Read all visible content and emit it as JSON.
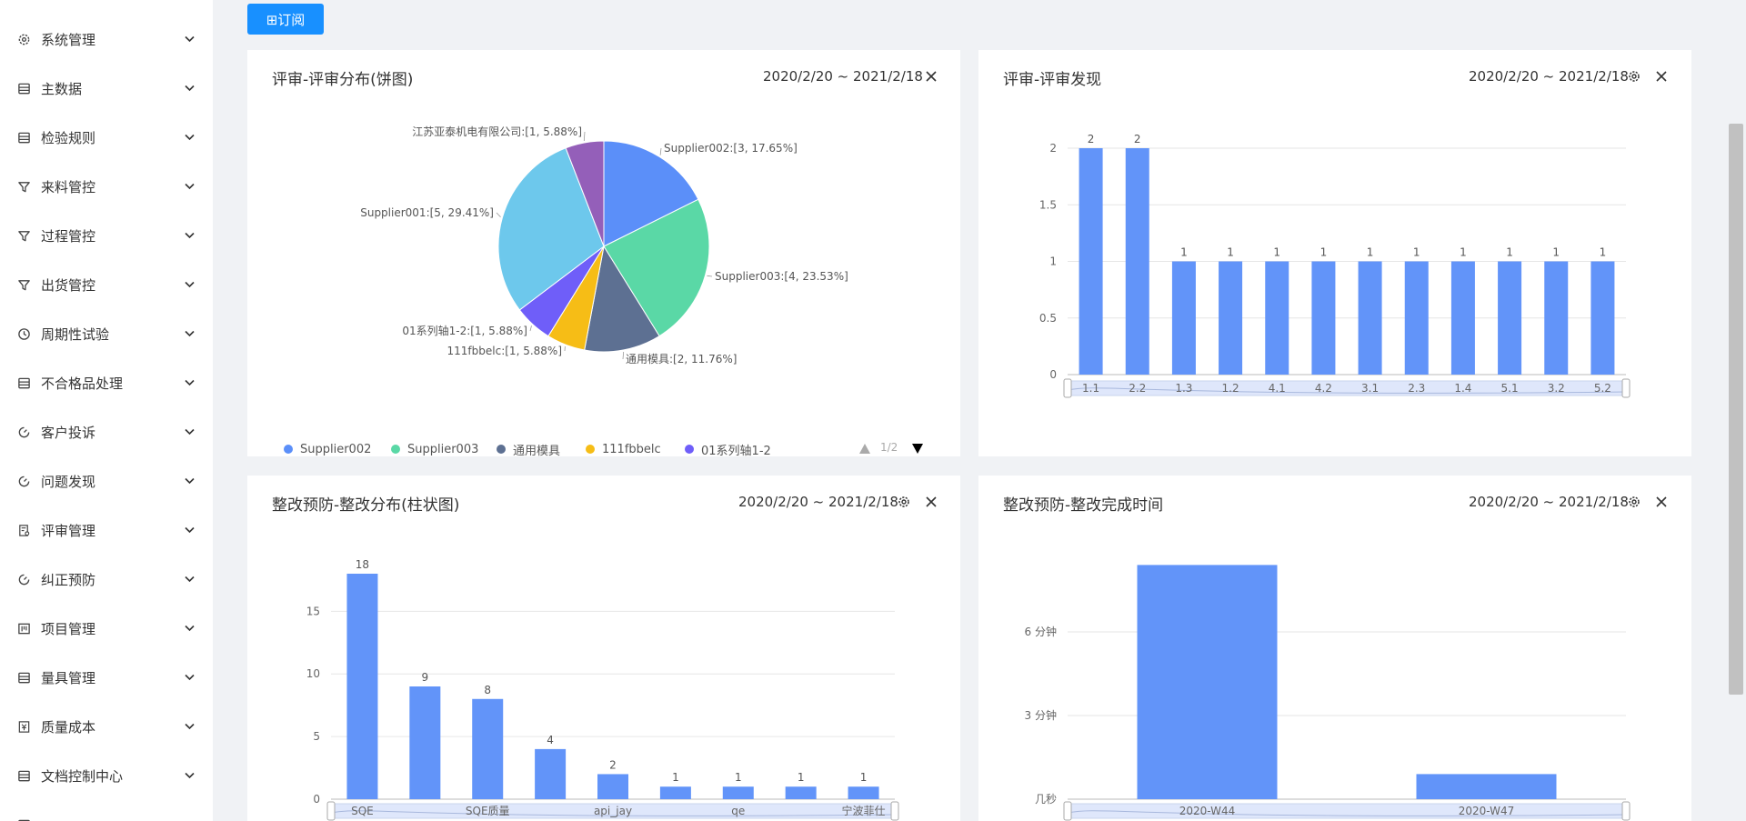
{
  "sidebar": {
    "items": [
      {
        "label": "系统管理",
        "icon": "gear-icon"
      },
      {
        "label": "主数据",
        "icon": "database-icon"
      },
      {
        "label": "检验规则",
        "icon": "database-icon"
      },
      {
        "label": "来料管控",
        "icon": "filter-icon"
      },
      {
        "label": "过程管控",
        "icon": "filter-icon"
      },
      {
        "label": "出货管控",
        "icon": "filter-icon"
      },
      {
        "label": "周期性试验",
        "icon": "clock-icon"
      },
      {
        "label": "不合格品处理",
        "icon": "database-icon"
      },
      {
        "label": "客户投诉",
        "icon": "dashboard-icon"
      },
      {
        "label": "问题发现",
        "icon": "dashboard-icon"
      },
      {
        "label": "评审管理",
        "icon": "audit-icon"
      },
      {
        "label": "纠正预防",
        "icon": "dashboard-icon"
      },
      {
        "label": "项目管理",
        "icon": "project-icon"
      },
      {
        "label": "量具管理",
        "icon": "database-icon"
      },
      {
        "label": "质量成本",
        "icon": "cost-icon"
      },
      {
        "label": "文档控制中心",
        "icon": "database-icon"
      },
      {
        "label": "",
        "icon": "database-icon"
      }
    ]
  },
  "toolbar": {
    "subscribe_label": "⊞订阅"
  },
  "cards": {
    "pie": {
      "title": "评审-评审分布(饼图)",
      "date": "2020/2/20 ~ 2021/2/18"
    },
    "review": {
      "title": "评审-评审发现",
      "date": "2020/2/20 ~ 2021/2/18"
    },
    "rect_bar": {
      "title": "整改预防-整改分布(柱状图)",
      "date": "2020/2/20 ~ 2021/2/18"
    },
    "rect_time": {
      "title": "整改预防-整改完成时间",
      "date": "2020/2/20 ~ 2021/2/18"
    }
  },
  "legend": {
    "items": [
      {
        "label": "Supplier002",
        "color": "#5b8ff9"
      },
      {
        "label": "Supplier003",
        "color": "#5ad8a6"
      },
      {
        "label": "通用模具",
        "color": "#5d7092"
      },
      {
        "label": "111fbbelc",
        "color": "#f6bd16"
      },
      {
        "label": "01系列轴1-2",
        "color": "#6f5ef9"
      }
    ],
    "page": "1/2"
  },
  "chart_data": [
    {
      "type": "pie",
      "title": "评审-评审分布(饼图)",
      "slices": [
        {
          "name": "Supplier002",
          "value": 3,
          "percent": 17.65,
          "label": "Supplier002:[3, 17.65%]",
          "color": "#5b8ff9"
        },
        {
          "name": "Supplier003",
          "value": 4,
          "percent": 23.53,
          "label": "Supplier003:[4, 23.53%]",
          "color": "#5ad8a6"
        },
        {
          "name": "通用模具",
          "value": 2,
          "percent": 11.76,
          "label": "通用模具:[2, 11.76%]",
          "color": "#5d7092"
        },
        {
          "name": "111fbbelc",
          "value": 1,
          "percent": 5.88,
          "label": "111fbbelc:[1, 5.88%]",
          "color": "#f6bd16"
        },
        {
          "name": "01系列轴1-2",
          "value": 1,
          "percent": 5.88,
          "label": "01系列轴1-2:[1, 5.88%]",
          "color": "#6f5ef9"
        },
        {
          "name": "Supplier001",
          "value": 5,
          "percent": 29.41,
          "label": "Supplier001:[5, 29.41%]",
          "color": "#6dc8ec"
        },
        {
          "name": "江苏亚泰机电有限公司",
          "value": 1,
          "percent": 5.88,
          "label": "江苏亚泰机电有限公司:[1, 5.88%]",
          "color": "#945fb9"
        }
      ]
    },
    {
      "type": "bar",
      "title": "评审-评审发现",
      "categories": [
        "1.1",
        "2.2",
        "1.3",
        "1.2",
        "4.1",
        "4.2",
        "3.1",
        "2.3",
        "1.4",
        "5.1",
        "3.2",
        "5.2"
      ],
      "values": [
        2,
        2,
        1,
        1,
        1,
        1,
        1,
        1,
        1,
        1,
        1,
        1
      ],
      "yticks": [
        0,
        0.5,
        1,
        1.5,
        2
      ],
      "ylim": [
        0,
        2
      ],
      "grid": true
    },
    {
      "type": "bar",
      "title": "整改预防-整改分布(柱状图)",
      "categories": [
        "SQE",
        "",
        "SQE质量",
        "",
        "api_jay",
        "",
        "qe",
        "",
        "宁波菲仕"
      ],
      "values": [
        18,
        9,
        8,
        4,
        2,
        1,
        1,
        1,
        1
      ],
      "yticks": [
        0,
        5,
        10,
        15
      ],
      "ylim": [
        0,
        18
      ],
      "grid": true
    },
    {
      "type": "bar",
      "title": "整改预防-整改完成时间",
      "categories": [
        "2020-W44",
        "2020-W47"
      ],
      "values": [
        8.4,
        0.9
      ],
      "yunit": "分钟",
      "yticks": [
        {
          "v": 0,
          "label": "几秒"
        },
        {
          "v": 3,
          "label": "3 分钟"
        },
        {
          "v": 6,
          "label": "6 分钟"
        }
      ],
      "ylim": [
        0,
        9
      ],
      "grid": true
    }
  ]
}
